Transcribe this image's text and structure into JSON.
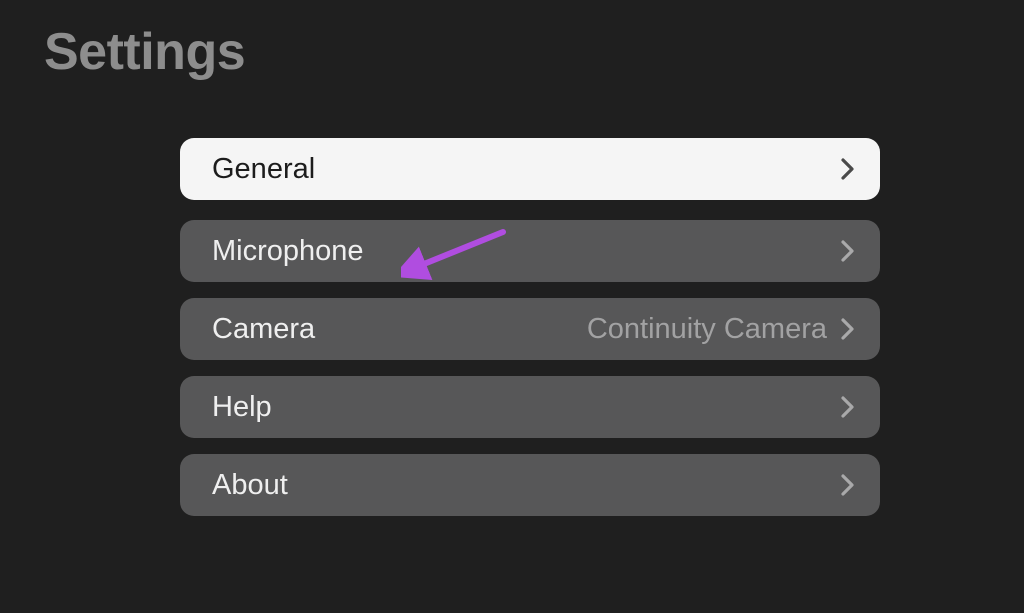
{
  "page_title": "Settings",
  "items": [
    {
      "label": "General",
      "value": "",
      "selected": true
    },
    {
      "label": "Microphone",
      "value": "",
      "selected": false
    },
    {
      "label": "Camera",
      "value": "Continuity Camera",
      "selected": false
    },
    {
      "label": "Help",
      "value": "",
      "selected": false
    },
    {
      "label": "About",
      "value": "",
      "selected": false
    }
  ],
  "annotation": {
    "color": "#b04de0",
    "points_to_item_index": 1
  }
}
